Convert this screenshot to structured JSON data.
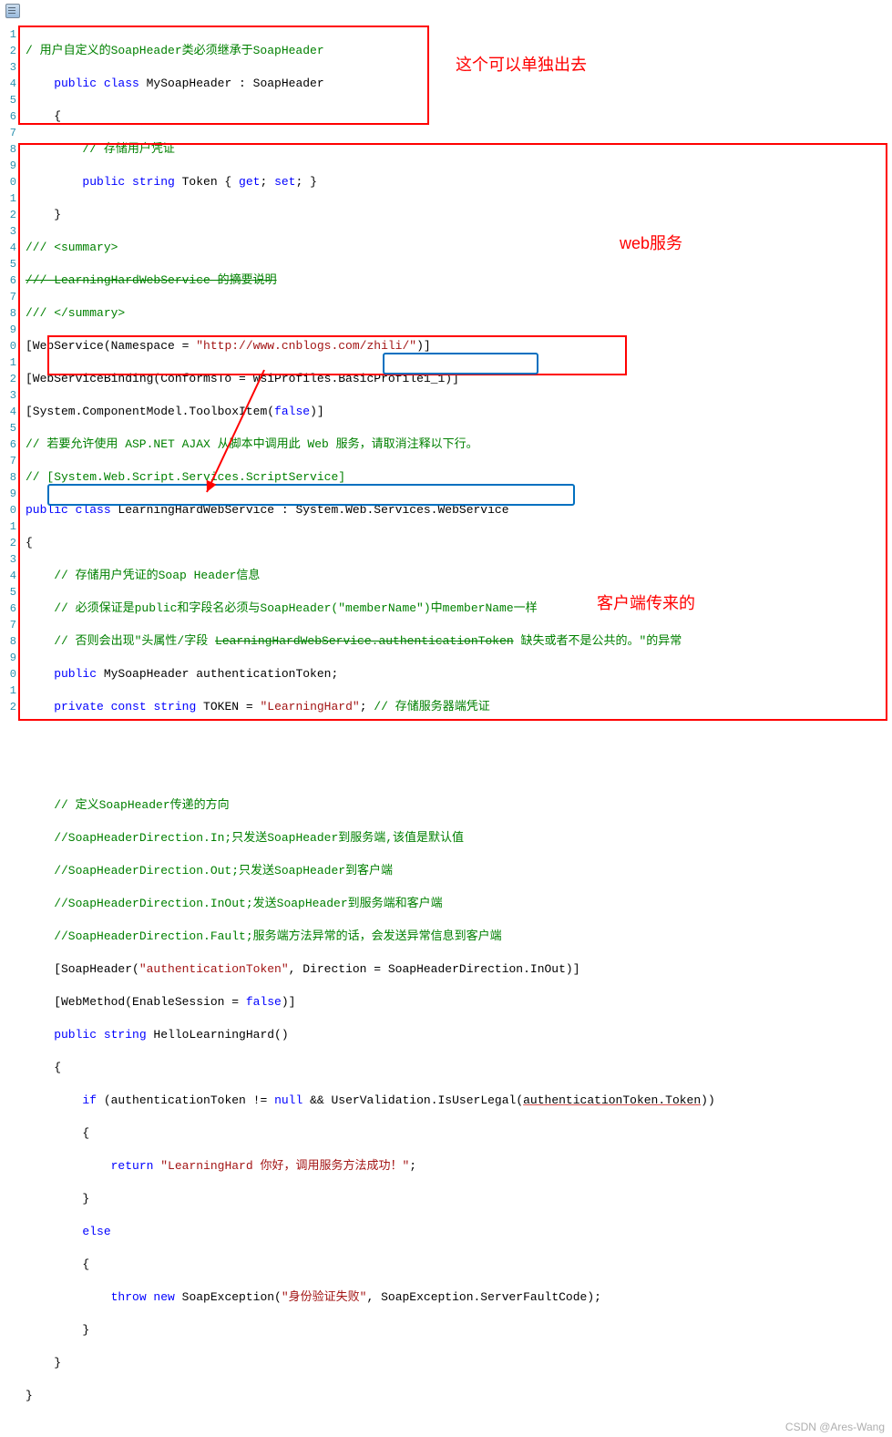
{
  "annotations": {
    "top_right": "这个可以单独出去",
    "web_service": "web服务",
    "client_sent": "客户端传来的"
  },
  "watermark": "CSDN @Ares-Wang",
  "code": {
    "l1": "/ 用户自定义的SoapHeader类必须继承于SoapHeader",
    "l2a": "    public",
    "l2b": " class",
    "l2c": " MySoapHeader : SoapHeader",
    "l3": "    {",
    "l4": "        // 存储用户凭证",
    "l5a": "        public",
    "l5b": " string",
    "l5c": " Token { ",
    "l5d": "get",
    "l5e": "; ",
    "l5f": "set",
    "l5g": "; }",
    "l6": "    }",
    "l7": "/// <summary>",
    "l8": "/// LearningHardWebService 的摘要说明",
    "l9": "/// </summary>",
    "l10a": "[WebService(Namespace = ",
    "l10b": "\"http://www.cnblogs.com/zhili/\"",
    "l10c": ")]",
    "l11a": "[WebServiceBinding(ConformsTo = WsiProfiles.BasicProfile1_1)]",
    "l12a": "[System.ComponentModel.ToolboxItem(",
    "l12b": "false",
    "l12c": ")]",
    "l13": "// 若要允许使用 ASP.NET AJAX 从脚本中调用此 Web 服务，请取消注释以下行。",
    "l14": "// [System.Web.Script.Services.ScriptService]",
    "l15a": "public",
    "l15b": " class",
    "l15c": " LearningHardWebService : System.Web.Services.WebService",
    "l16": "{",
    "l17": "    // 存储用户凭证的Soap Header信息",
    "l18": "    // 必须保证是public和字段名必须与SoapHeader(\"memberName\")中memberName一样",
    "l19a": "    // 否则会出现\"头属性/字段 ",
    "l19b": "LearningHardWebService.authenticationToken",
    "l19c": " 缺失或者不是公共的。\"的异常",
    "l20a": "    public",
    "l20b": " MySoapHeader authenticationToken;",
    "l21a": "    private",
    "l21b": " const",
    "l21c": " string",
    "l21d": " TOKEN = ",
    "l21e": "\"LearningHard\"",
    "l21f": ";",
    "l21g": " // 存储服务器端凭证",
    "l22": "",
    "l23": "",
    "l24": "    // 定义SoapHeader传递的方向",
    "l25": "    //SoapHeaderDirection.In;只发送SoapHeader到服务端,该值是默认值",
    "l26": "    //SoapHeaderDirection.Out;只发送SoapHeader到客户端",
    "l27": "    //SoapHeaderDirection.InOut;发送SoapHeader到服务端和客户端",
    "l28": "    //SoapHeaderDirection.Fault;服务端方法异常的话，会发送异常信息到客户端",
    "l29a": "    [SoapHeader(",
    "l29b": "\"authenticationToken\"",
    "l29c": ", Direction = SoapHeaderDirection.InOut)]",
    "l30a": "    [WebMethod(EnableSession = ",
    "l30b": "false",
    "l30c": ")]",
    "l31a": "    public",
    "l31b": " string",
    "l31c": " HelloLearningHard()",
    "l32": "    {",
    "l33a": "        if",
    "l33b": " (authenticationToken != ",
    "l33c": "null",
    "l33d": " && UserValidation.IsUserLegal(",
    "l33e": "authenticationToken.Token",
    "l33f": "))",
    "l34": "        {",
    "l35a": "            return",
    "l35b": " \"LearningHard 你好，调用服务方法成功！\"",
    "l35c": ";",
    "l36": "        }",
    "l37a": "        else",
    "l38": "        {",
    "l39a": "            throw",
    "l39b": " new",
    "l39c": " SoapException(",
    "l39d": "\"身份验证失败\"",
    "l39e": ", SoapException.ServerFaultCode);",
    "l40": "        }",
    "l41": "    }",
    "l42": "}"
  },
  "line_numbers": [
    "1",
    "2",
    "3",
    "4",
    "5",
    "6",
    "7",
    "8",
    "9",
    "0",
    "1",
    "2",
    "3",
    "4",
    "5",
    "6",
    "7",
    "8",
    "9",
    "0",
    "1",
    "2",
    "3",
    "4",
    "5",
    "6",
    "7",
    "8",
    "9",
    "0",
    "1",
    "2",
    "3",
    "4",
    "5",
    "6",
    "7",
    "8",
    "9",
    "0",
    "1",
    "2"
  ]
}
